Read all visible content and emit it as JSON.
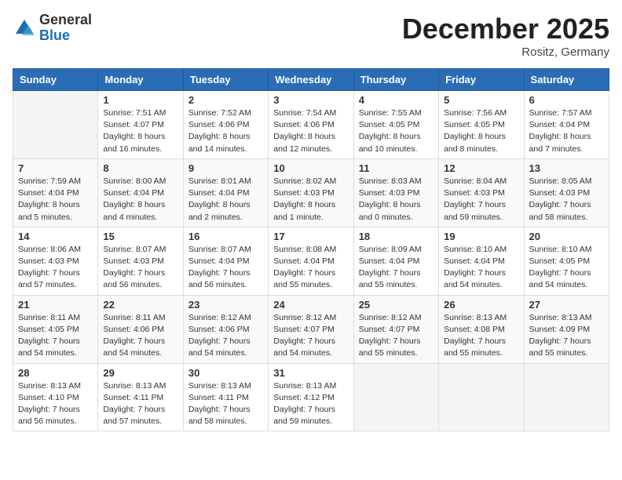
{
  "logo": {
    "general": "General",
    "blue": "Blue"
  },
  "title": "December 2025",
  "location": "Rositz, Germany",
  "days_of_week": [
    "Sunday",
    "Monday",
    "Tuesday",
    "Wednesday",
    "Thursday",
    "Friday",
    "Saturday"
  ],
  "weeks": [
    [
      {
        "day": null,
        "info": null
      },
      {
        "day": "1",
        "info": "Sunrise: 7:51 AM\nSunset: 4:07 PM\nDaylight: 8 hours\nand 16 minutes."
      },
      {
        "day": "2",
        "info": "Sunrise: 7:52 AM\nSunset: 4:06 PM\nDaylight: 8 hours\nand 14 minutes."
      },
      {
        "day": "3",
        "info": "Sunrise: 7:54 AM\nSunset: 4:06 PM\nDaylight: 8 hours\nand 12 minutes."
      },
      {
        "day": "4",
        "info": "Sunrise: 7:55 AM\nSunset: 4:05 PM\nDaylight: 8 hours\nand 10 minutes."
      },
      {
        "day": "5",
        "info": "Sunrise: 7:56 AM\nSunset: 4:05 PM\nDaylight: 8 hours\nand 8 minutes."
      },
      {
        "day": "6",
        "info": "Sunrise: 7:57 AM\nSunset: 4:04 PM\nDaylight: 8 hours\nand 7 minutes."
      }
    ],
    [
      {
        "day": "7",
        "info": "Sunrise: 7:59 AM\nSunset: 4:04 PM\nDaylight: 8 hours\nand 5 minutes."
      },
      {
        "day": "8",
        "info": "Sunrise: 8:00 AM\nSunset: 4:04 PM\nDaylight: 8 hours\nand 4 minutes."
      },
      {
        "day": "9",
        "info": "Sunrise: 8:01 AM\nSunset: 4:04 PM\nDaylight: 8 hours\nand 2 minutes."
      },
      {
        "day": "10",
        "info": "Sunrise: 8:02 AM\nSunset: 4:03 PM\nDaylight: 8 hours\nand 1 minute."
      },
      {
        "day": "11",
        "info": "Sunrise: 8:03 AM\nSunset: 4:03 PM\nDaylight: 8 hours\nand 0 minutes."
      },
      {
        "day": "12",
        "info": "Sunrise: 8:04 AM\nSunset: 4:03 PM\nDaylight: 7 hours\nand 59 minutes."
      },
      {
        "day": "13",
        "info": "Sunrise: 8:05 AM\nSunset: 4:03 PM\nDaylight: 7 hours\nand 58 minutes."
      }
    ],
    [
      {
        "day": "14",
        "info": "Sunrise: 8:06 AM\nSunset: 4:03 PM\nDaylight: 7 hours\nand 57 minutes."
      },
      {
        "day": "15",
        "info": "Sunrise: 8:07 AM\nSunset: 4:03 PM\nDaylight: 7 hours\nand 56 minutes."
      },
      {
        "day": "16",
        "info": "Sunrise: 8:07 AM\nSunset: 4:04 PM\nDaylight: 7 hours\nand 56 minutes."
      },
      {
        "day": "17",
        "info": "Sunrise: 8:08 AM\nSunset: 4:04 PM\nDaylight: 7 hours\nand 55 minutes."
      },
      {
        "day": "18",
        "info": "Sunrise: 8:09 AM\nSunset: 4:04 PM\nDaylight: 7 hours\nand 55 minutes."
      },
      {
        "day": "19",
        "info": "Sunrise: 8:10 AM\nSunset: 4:04 PM\nDaylight: 7 hours\nand 54 minutes."
      },
      {
        "day": "20",
        "info": "Sunrise: 8:10 AM\nSunset: 4:05 PM\nDaylight: 7 hours\nand 54 minutes."
      }
    ],
    [
      {
        "day": "21",
        "info": "Sunrise: 8:11 AM\nSunset: 4:05 PM\nDaylight: 7 hours\nand 54 minutes."
      },
      {
        "day": "22",
        "info": "Sunrise: 8:11 AM\nSunset: 4:06 PM\nDaylight: 7 hours\nand 54 minutes."
      },
      {
        "day": "23",
        "info": "Sunrise: 8:12 AM\nSunset: 4:06 PM\nDaylight: 7 hours\nand 54 minutes."
      },
      {
        "day": "24",
        "info": "Sunrise: 8:12 AM\nSunset: 4:07 PM\nDaylight: 7 hours\nand 54 minutes."
      },
      {
        "day": "25",
        "info": "Sunrise: 8:12 AM\nSunset: 4:07 PM\nDaylight: 7 hours\nand 55 minutes."
      },
      {
        "day": "26",
        "info": "Sunrise: 8:13 AM\nSunset: 4:08 PM\nDaylight: 7 hours\nand 55 minutes."
      },
      {
        "day": "27",
        "info": "Sunrise: 8:13 AM\nSunset: 4:09 PM\nDaylight: 7 hours\nand 55 minutes."
      }
    ],
    [
      {
        "day": "28",
        "info": "Sunrise: 8:13 AM\nSunset: 4:10 PM\nDaylight: 7 hours\nand 56 minutes."
      },
      {
        "day": "29",
        "info": "Sunrise: 8:13 AM\nSunset: 4:11 PM\nDaylight: 7 hours\nand 57 minutes."
      },
      {
        "day": "30",
        "info": "Sunrise: 8:13 AM\nSunset: 4:11 PM\nDaylight: 7 hours\nand 58 minutes."
      },
      {
        "day": "31",
        "info": "Sunrise: 8:13 AM\nSunset: 4:12 PM\nDaylight: 7 hours\nand 59 minutes."
      },
      {
        "day": null,
        "info": null
      },
      {
        "day": null,
        "info": null
      },
      {
        "day": null,
        "info": null
      }
    ]
  ]
}
